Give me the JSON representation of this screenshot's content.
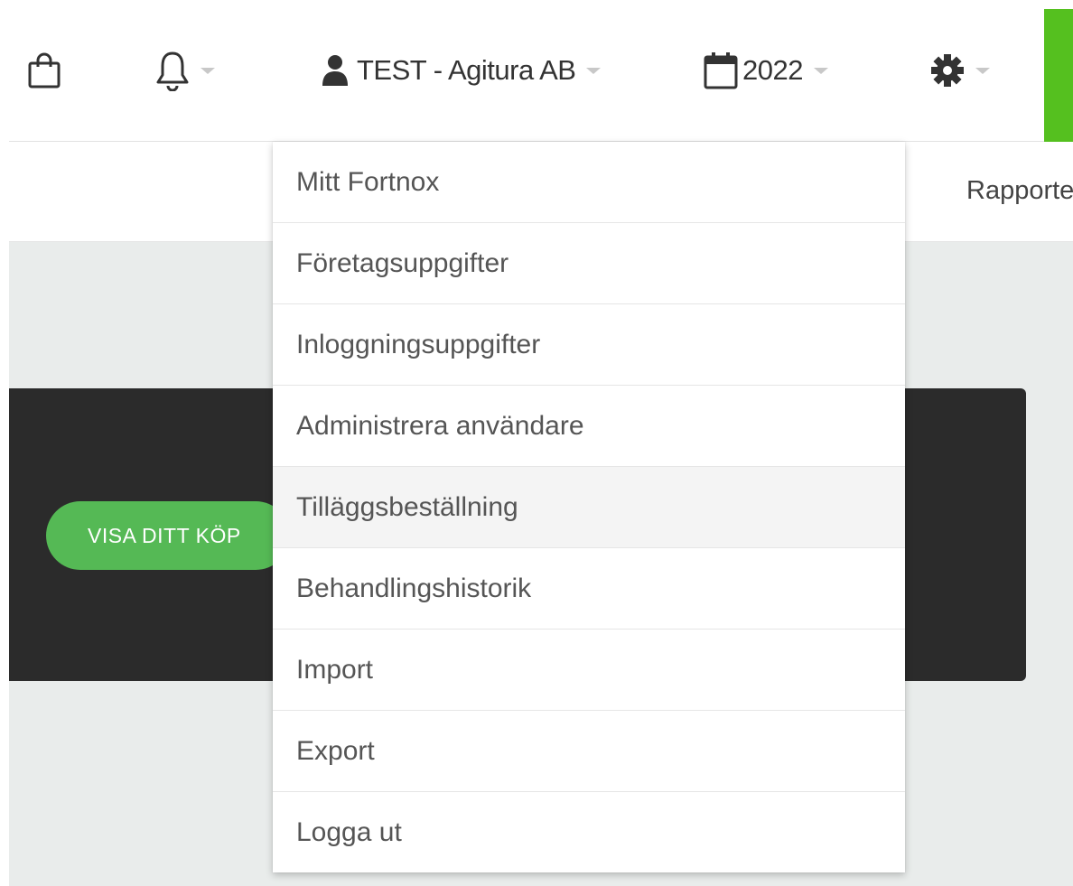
{
  "topbar": {
    "icons": {
      "shop": "shopping-bag-icon",
      "notifications": "bell-icon",
      "user": "user-icon",
      "year": "calendar-icon",
      "settings": "gear-icon"
    },
    "company_label": "TEST - Agitura AB",
    "year_label": "2022"
  },
  "subnav": {
    "reports_label": "Rapporter"
  },
  "banner": {
    "button_label": "VISA DITT KÖP"
  },
  "dropdown": {
    "items": [
      {
        "label": "Mitt Fortnox"
      },
      {
        "label": "Företagsuppgifter"
      },
      {
        "label": "Inloggningsuppgifter"
      },
      {
        "label": "Administrera användare"
      },
      {
        "label": "Tilläggsbeställning"
      },
      {
        "label": "Behandlingshistorik"
      },
      {
        "label": "Import"
      },
      {
        "label": "Export"
      },
      {
        "label": "Logga ut"
      }
    ],
    "hovered_index": 4
  },
  "colors": {
    "accent_green": "#55c01f",
    "button_green": "#55b955",
    "banner_dark": "#2b2b2b",
    "content_bg": "#e9eceb"
  }
}
